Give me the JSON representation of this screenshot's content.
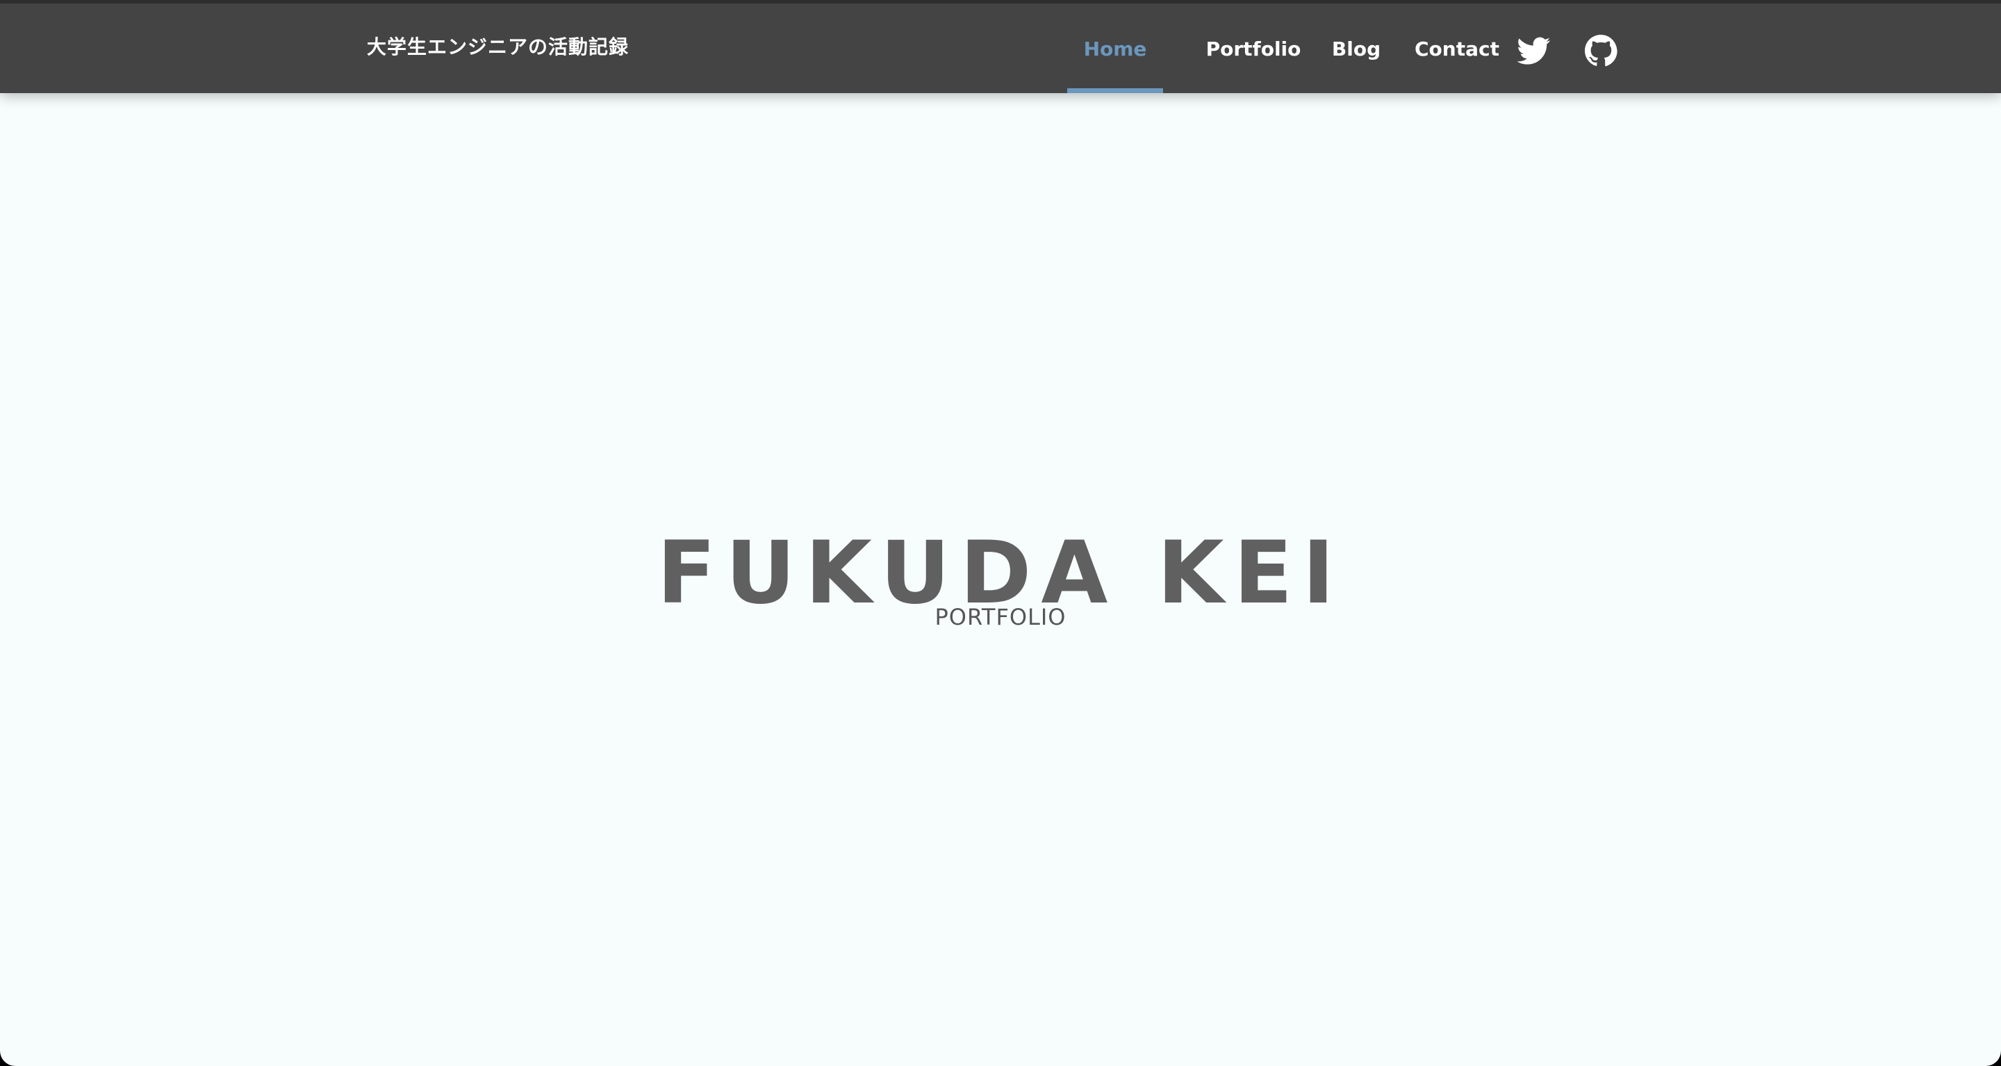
{
  "header": {
    "site_title": "大学生エンジニアの活動記録",
    "nav": [
      {
        "label": "Home",
        "active": true
      },
      {
        "label": "Portfolio",
        "active": false
      },
      {
        "label": "Blog",
        "active": false
      },
      {
        "label": "Contact",
        "active": false
      }
    ],
    "social_icons": [
      "twitter-icon",
      "github-icon"
    ]
  },
  "hero": {
    "name": "FUKUDA KEI",
    "subtitle": "PORTFOLIO"
  },
  "colors": {
    "header_bg": "#444444",
    "accent": "#6b97bd",
    "page_bg": "#f7fdfd",
    "hero_text": "#606060"
  }
}
